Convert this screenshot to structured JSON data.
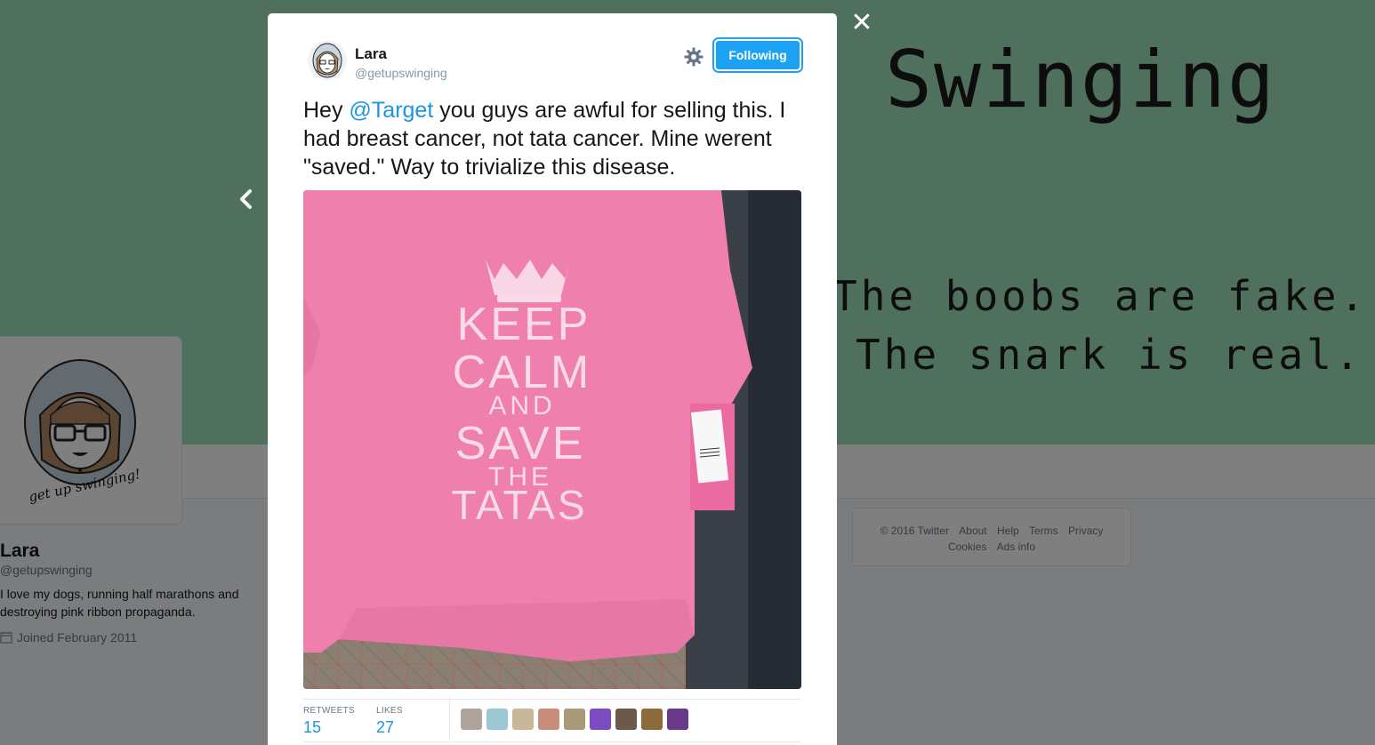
{
  "profile_banner": {
    "title": "Swinging",
    "line1": "The boobs are fake.",
    "line2": "The snark is real."
  },
  "profile": {
    "name": "Lara",
    "handle": "@getupswinging",
    "bio": "I love my dogs, running half marathons and destroying pink ribbon propaganda.",
    "joined": "Joined February 2011",
    "avatar_caption": "get up swinging!"
  },
  "footer": {
    "row1": [
      "© 2016 Twitter",
      "About",
      "Help",
      "Terms",
      "Privacy"
    ],
    "row2": [
      "Cookies",
      "Ads info"
    ]
  },
  "modal": {
    "close_icon": "close-icon",
    "prev_icon": "chevron-left-icon"
  },
  "tweet": {
    "name": "Lara",
    "handle": "@getupswinging",
    "follow_label": "Following",
    "text_pre": "Hey ",
    "mention": "@Target",
    "text_post": " you guys are awful for selling this. I had breast cancer, not tata cancer. Mine werent \"saved.\" Way to trivialize this disease.",
    "photo_text": [
      "KEEP",
      "CALM",
      "AND",
      "SAVE",
      "THE",
      "TATAS"
    ],
    "retweets_label": "RETWEETS",
    "retweets": "15",
    "likes_label": "LIKES",
    "likes": "27"
  },
  "colors": {
    "accent": "#1da1f2",
    "link": "#1b95e0",
    "banner": "#9fe0bb",
    "shirt": "#ef7fac"
  },
  "likers": [
    "#b0a39a",
    "#9ec7d4",
    "#c8b89a",
    "#c78c7a",
    "#a99a7a",
    "#7b4bc4",
    "#6b5a4a",
    "#8c6a3a",
    "#6a3a8a"
  ]
}
